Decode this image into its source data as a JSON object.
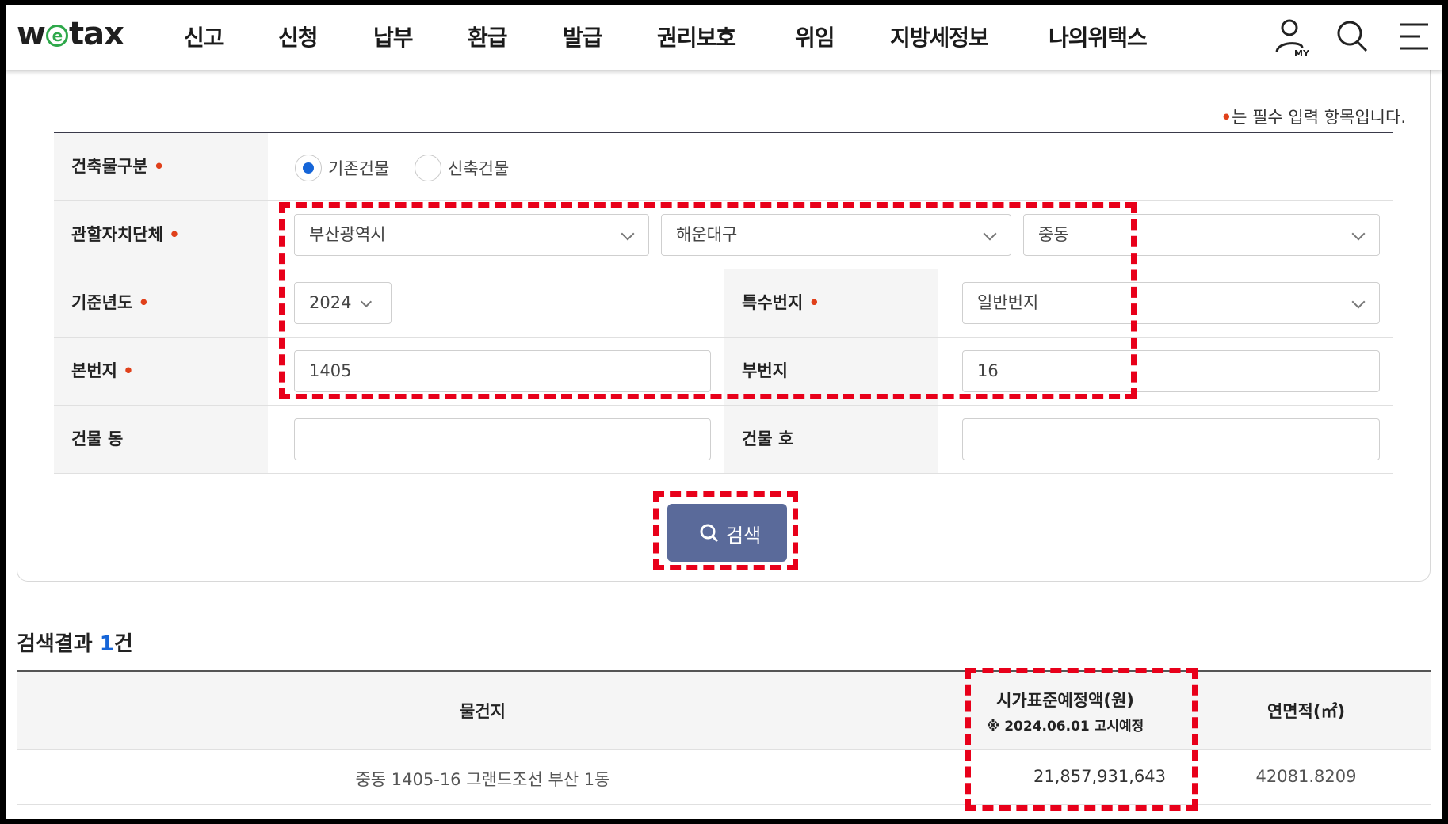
{
  "header": {
    "logo": {
      "pre": "w",
      "mid": "e",
      "post": "tax"
    },
    "nav": [
      "신고",
      "신청",
      "납부",
      "환급",
      "발급",
      "권리보호",
      "위임",
      "지방세정보",
      "나의위택스"
    ],
    "icons": [
      "my-page-icon",
      "search-icon",
      "menu-icon"
    ],
    "my_label": "MY"
  },
  "form": {
    "required_mark": "•",
    "required_note": "는 필수 입력 항목입니다.",
    "building_type": {
      "label": "건축물구분",
      "options": [
        "기존건물",
        "신축건물"
      ],
      "selected": "기존건물"
    },
    "jurisdiction": {
      "label": "관할자치단체",
      "sido": "부산광역시",
      "sigungu": "해운대구",
      "dong": "중동"
    },
    "base_year": {
      "label": "기준년도",
      "value": "2024"
    },
    "special_lot": {
      "label": "특수번지",
      "value": "일반번지"
    },
    "main_lot": {
      "label": "본번지",
      "value": "1405"
    },
    "sub_lot": {
      "label": "부번지",
      "value": "16"
    },
    "building_dong": {
      "label": "건물 동",
      "value": ""
    },
    "building_ho": {
      "label": "건물 호",
      "value": ""
    },
    "search_button": "검색"
  },
  "result": {
    "title_prefix": "검색결과 ",
    "count": "1",
    "title_suffix": "건",
    "columns": {
      "location": "물건지",
      "price": "시가표준예정액(원)",
      "price_note": "※ 2024.06.01 고시예정",
      "area": "연면적(㎡)"
    },
    "rows": [
      {
        "location": "중동 1405-16 그랜드조선 부산 1동",
        "price": "21,857,931,643",
        "area": "42081.8209"
      }
    ]
  },
  "colors": {
    "accent_blue": "#1565d8",
    "required_red": "#e0401a",
    "button": "#5a6a9a",
    "highlight": "#e8001a"
  }
}
